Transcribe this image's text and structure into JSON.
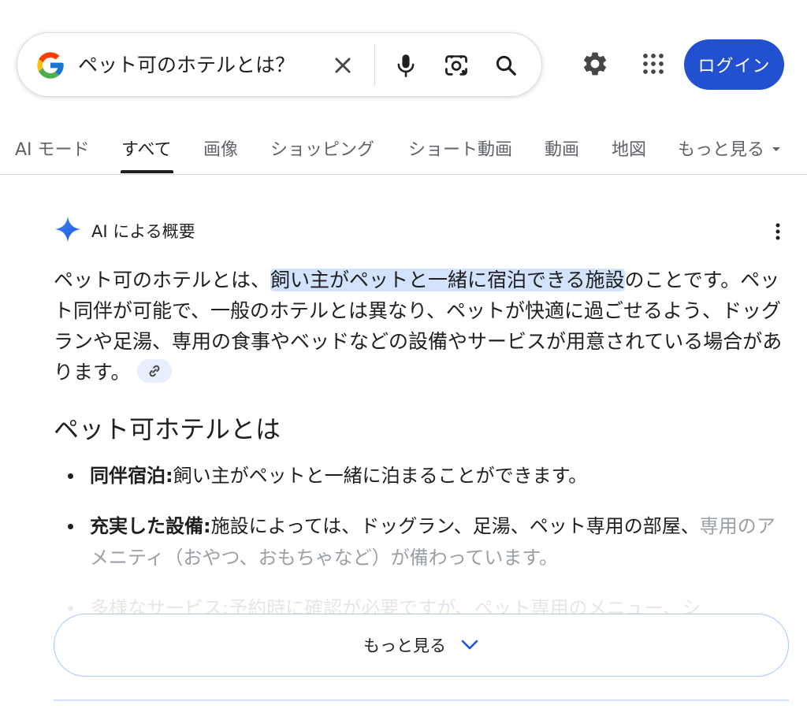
{
  "search": {
    "query": "ペット可のホテルとは？",
    "clear_icon": "close-icon",
    "voice_icon": "microphone-icon",
    "lens_icon": "camera-lens-icon",
    "search_icon": "magnifier-icon"
  },
  "header": {
    "settings_icon": "gear-icon",
    "apps_icon": "grid-icon",
    "login_label": "ログイン"
  },
  "tabs": [
    {
      "label": "AI モード"
    },
    {
      "label": "すべて",
      "active": true
    },
    {
      "label": "画像"
    },
    {
      "label": "ショッピング"
    },
    {
      "label": "ショート動画"
    },
    {
      "label": "動画"
    },
    {
      "label": "地図"
    },
    {
      "label": "もっと見る"
    }
  ],
  "ai_overview": {
    "title": "AI による概要",
    "intro_before": "ペット可のホテルとは、",
    "intro_highlight": "飼い主がペットと一緒に宿泊できる施設",
    "intro_after": "のことです。ペット同伴が可能で、一般のホテルとは異なり、ペットが快適に過ごせるよう、ドッグランや足湯、専用の食事やベッドなどの設備やサービスが用意されている場合があります。",
    "heading": "ペット可ホテルとは",
    "bullets": [
      {
        "term": "同伴宿泊:",
        "text": "飼い主がペットと一緒に泊まることができます。"
      },
      {
        "term": "充実した設備:",
        "text": "施設によっては、ドッグラン、足湯、ペット専用の部屋、",
        "text_faded": "専用のアメニティ（おやつ、おもちゃなど）が備わっています。"
      },
      {
        "text": "多様なサービス:予約時に確認が必要ですが、ペット専用のメニュー、シ"
      }
    ],
    "more_label": "もっと見る"
  },
  "colors": {
    "accent": "#2150d0",
    "highlight": "#d3e3fd",
    "border": "#a8c7fa"
  }
}
